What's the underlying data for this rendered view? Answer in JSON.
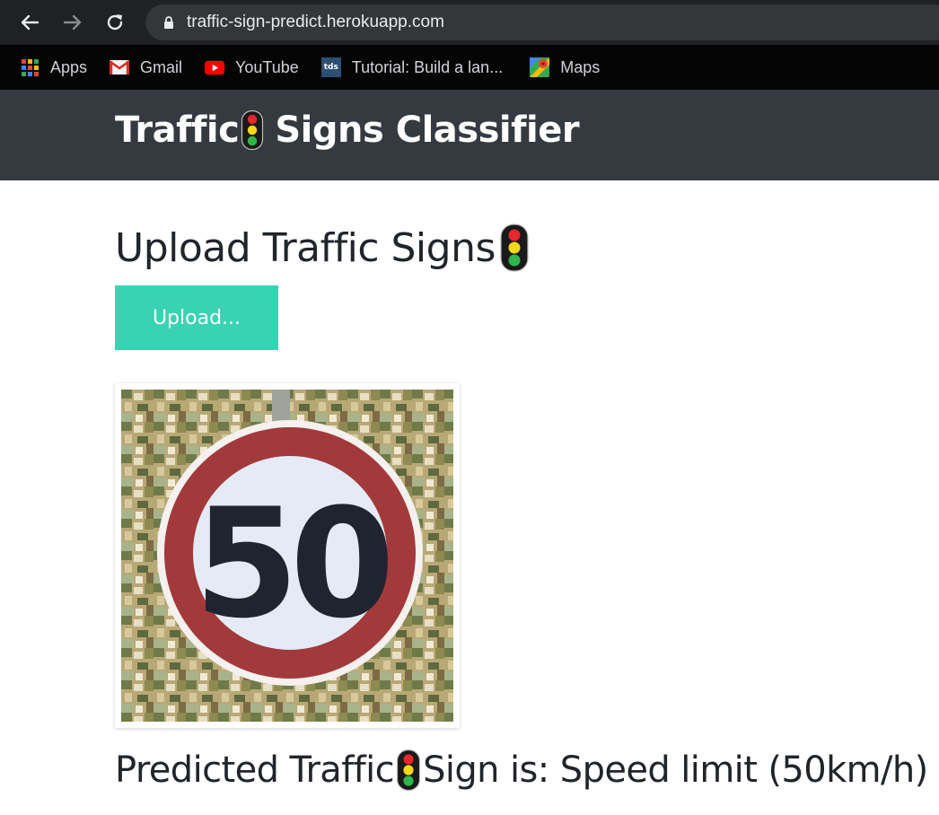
{
  "browser": {
    "url": "traffic-sign-predict.herokuapp.com",
    "bookmarks": [
      {
        "label": "Apps",
        "icon": "apps-grid-icon"
      },
      {
        "label": "Gmail",
        "icon": "gmail-icon"
      },
      {
        "label": "YouTube",
        "icon": "youtube-icon"
      },
      {
        "label": "Tutorial: Build a lan...",
        "icon": "tds-icon",
        "icon_text": "tds"
      },
      {
        "label": "Maps",
        "icon": "maps-icon"
      }
    ]
  },
  "navbar": {
    "brand_prefix": "Traffic",
    "brand_suffix": "Signs Classifier",
    "icon": "traffic-light-icon"
  },
  "main": {
    "heading": "Upload Traffic Signs",
    "upload_label": "Upload...",
    "sign_text": "50",
    "prediction_prefix": "Predicted Traffic",
    "prediction_suffix": "Sign is: Speed limit (50km/h)"
  },
  "colors": {
    "navbar_bg": "#343a40",
    "upload_button": "#39d3b4",
    "chrome_bg": "#202124"
  }
}
